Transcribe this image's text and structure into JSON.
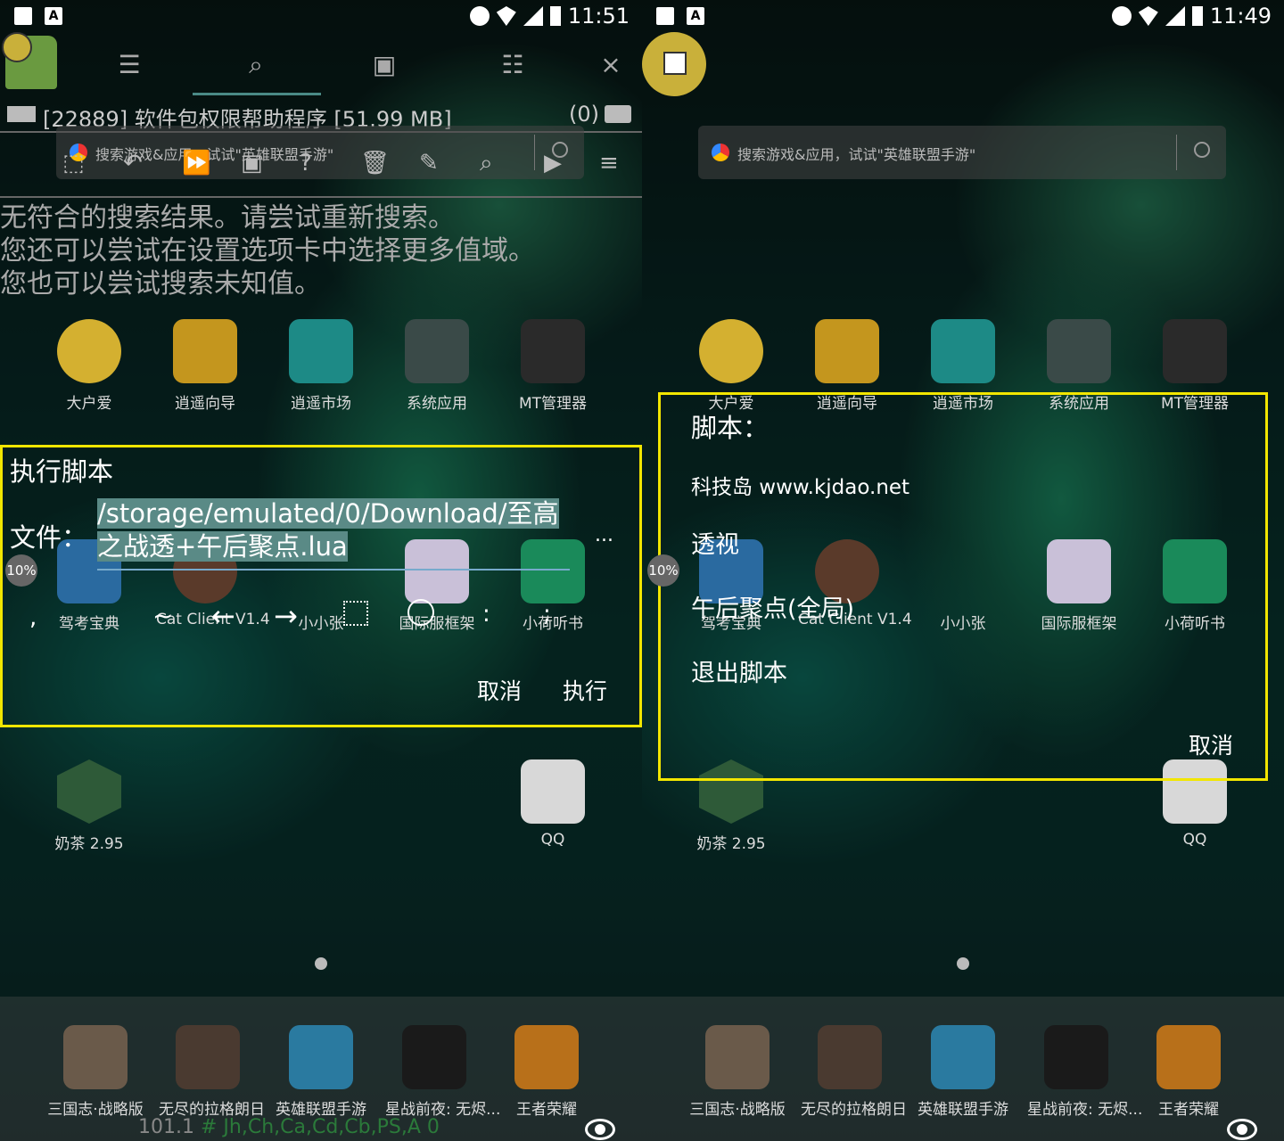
{
  "left": {
    "status": {
      "time": "11:51"
    },
    "toolbar": {
      "close": "×"
    },
    "process": {
      "info": "[22889] 软件包权限帮助程序 [51.99 MB]",
      "count": "(0)"
    },
    "search_placeholder": "搜索游戏&应用，试试\"英雄联盟手游\"",
    "no_result": [
      "无符合的搜索结果。请尝试重新搜索。",
      "您还可以尝试在设置选项卡中选择更多值域。",
      "您也可以尝试搜索未知值。"
    ],
    "apps_row1": [
      "大户爱",
      "逍遥向导",
      "逍遥市场",
      "系统应用",
      "MT管理器"
    ],
    "apps_row2": [
      "驾考宝典",
      "Cat Client V1.4",
      "小小张",
      "国际服框架",
      "小荷听书"
    ],
    "apps_row3": [
      "奶茶 2.95",
      "QQ"
    ],
    "dock": [
      "三国志·战略版",
      "无尽的拉格朗日",
      "英雄联盟手游",
      "星战前夜: 无烬...",
      "王者荣耀"
    ],
    "dialog": {
      "title": "执行脚本",
      "file_label": "文件：",
      "file_path": "/storage/emulated/0/Download/至高之战透+午后聚点.lua",
      "more": "...",
      "keys": [
        ",",
        "~",
        "←",
        "→",
        ":",
        ";"
      ],
      "cancel": "取消",
      "execute": "执行"
    },
    "pct": "10%",
    "bottom": {
      "value": "101.1",
      "hash": "#",
      "regions": "Jh,Ch,Ca,Cd,Cb,PS,A 0"
    }
  },
  "right": {
    "status": {
      "time": "11:49"
    },
    "search_placeholder": "搜索游戏&应用，试试\"英雄联盟手游\"",
    "apps_row1": [
      "大户爱",
      "逍遥向导",
      "逍遥市场",
      "系统应用",
      "MT管理器"
    ],
    "apps_row2": [
      "驾考宝典",
      "Cat Client V1.4",
      "小小张",
      "国际服框架",
      "小荷听书"
    ],
    "apps_row3": [
      "奶茶 2.95",
      "QQ"
    ],
    "dock": [
      "三国志·战略版",
      "无尽的拉格朗日",
      "英雄联盟手游",
      "星战前夜: 无烬...",
      "王者荣耀"
    ],
    "menu": {
      "title": "脚本：",
      "items": [
        "科技岛 www.kjdao.net",
        "透视",
        "午后聚点(全局)",
        "退出脚本"
      ],
      "cancel": "取消"
    },
    "pct": "10%"
  },
  "colors": {
    "highlight": "#f2e600",
    "selection": "#5a8a86"
  }
}
